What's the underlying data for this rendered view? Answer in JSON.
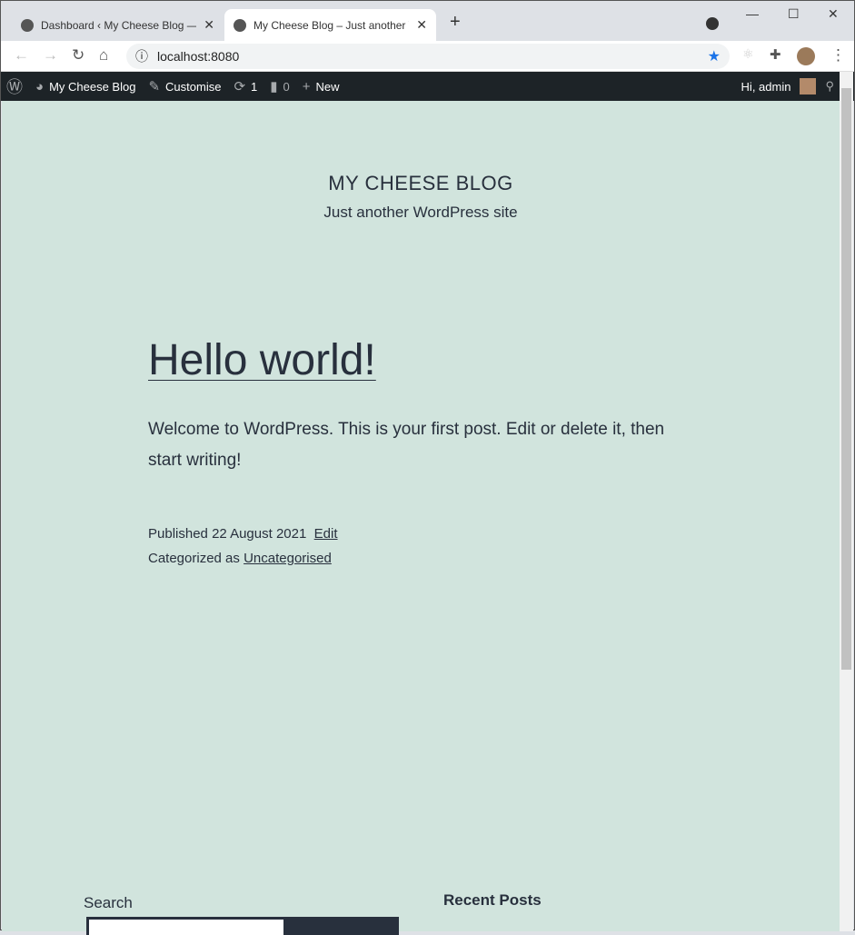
{
  "browser": {
    "tabs": [
      {
        "title": "Dashboard ‹ My Cheese Blog — W",
        "active": false
      },
      {
        "title": "My Cheese Blog – Just another W",
        "active": true
      }
    ],
    "url": "localhost:8080"
  },
  "adminbar": {
    "site": "My Cheese Blog",
    "customise": "Customise",
    "updates": "1",
    "comments": "0",
    "new": "New",
    "greeting": "Hi, admin"
  },
  "site": {
    "title": "MY CHEESE BLOG",
    "description": "Just another WordPress site"
  },
  "post": {
    "title": "Hello world!",
    "body": "Welcome to WordPress. This is your first post. Edit or delete it, then start writing!",
    "published_label": "Published",
    "date": "22 August 2021",
    "edit": "Edit",
    "categorized_label": "Categorized as",
    "category": "Uncategorised"
  },
  "widgets": {
    "search_heading": "Search",
    "recent_heading": "Recent Posts"
  }
}
